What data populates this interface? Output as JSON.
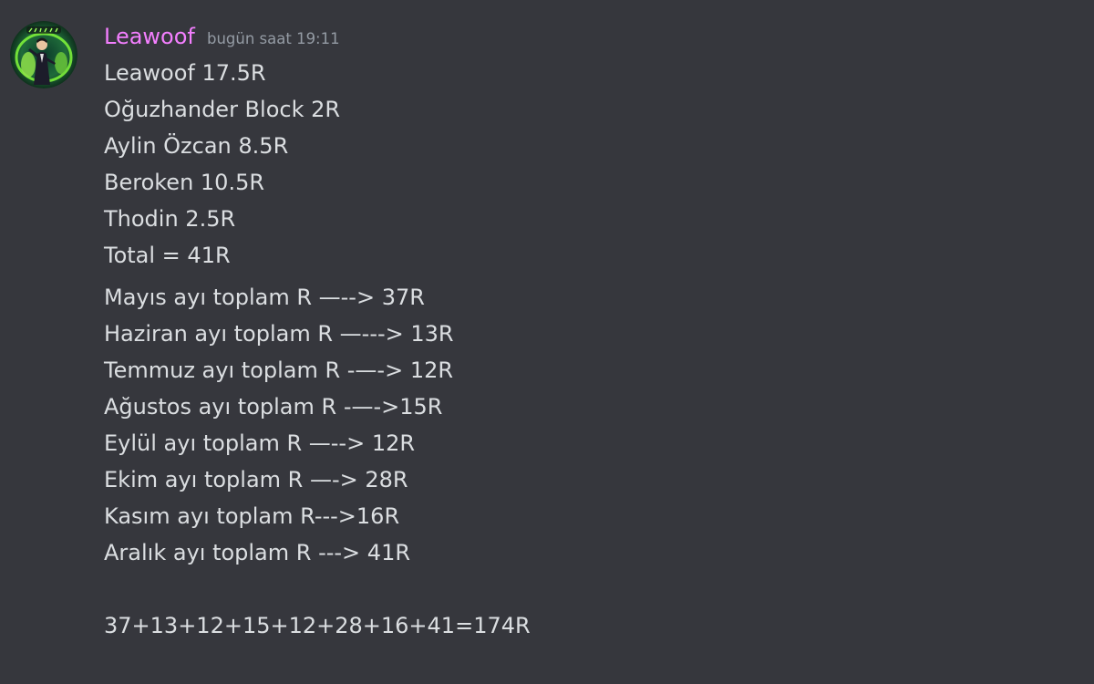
{
  "message": {
    "author": "Leawoof",
    "timestamp": "bugün saat 19:11",
    "avatar_icon": "avatar-character-icon",
    "colors": {
      "background": "#36373d",
      "username": "#f47fff",
      "timestamp": "#949ba4",
      "text": "#dbdee1"
    },
    "lines_block1": [
      "Leawoof 17.5R",
      "Oğuzhander Block 2R",
      "Aylin Özcan 8.5R",
      "Beroken 10.5R",
      "Thodin 2.5R",
      "Total = 41R"
    ],
    "lines_block2": [
      "Mayıs ayı toplam R —--> 37R",
      "Haziran ayı toplam R —---> 13R",
      "Temmuz ayı toplam R -—-> 12R",
      "Ağustos ayı toplam R -—->15R",
      "Eylül ayı toplam R —--> 12R",
      "Ekim ayı toplam R —-> 28R",
      "Kasım ayı toplam R--->16R",
      "Aralık ayı toplam R ---> 41R"
    ],
    "total_line": "37+13+12+15+12+28+16+41=174R"
  }
}
